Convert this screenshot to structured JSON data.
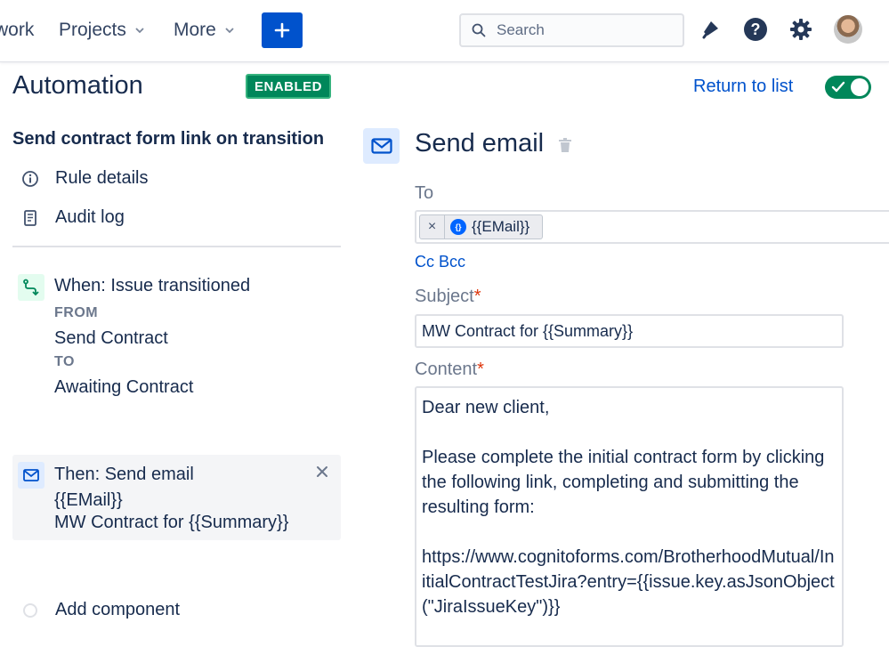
{
  "nav": {
    "work_label": "work",
    "projects_label": "Projects",
    "more_label": "More",
    "create_icon": "plus-icon",
    "search_placeholder": "Search",
    "icons": [
      "notification-icon",
      "help-icon",
      "settings-icon",
      "avatar"
    ]
  },
  "header": {
    "title": "Automation",
    "status_badge": "ENABLED",
    "return_link": "Return to list",
    "rule_enabled": true
  },
  "sidebar": {
    "rule_name": "Send contract form link on transition",
    "links": [
      {
        "label": "Rule details",
        "icon": "info-icon"
      },
      {
        "label": "Audit log",
        "icon": "audit-log-icon"
      }
    ],
    "trigger": {
      "label": "When: Issue transitioned",
      "from_label": "FROM",
      "from_value": "Send Contract",
      "to_label": "TO",
      "to_value": "Awaiting Contract"
    },
    "action": {
      "label": "Then: Send email",
      "line1": "{{EMail}}",
      "line2": "MW Contract for {{Summary}}"
    },
    "add_component": "Add component"
  },
  "editor": {
    "title": "Send email",
    "to_label": "To",
    "to_chip": "{{EMail}}",
    "cc_bcc": "Cc Bcc",
    "subject_label": "Subject",
    "subject_value": "MW Contract for {{Summary}}",
    "content_label": "Content",
    "required_marker": "*",
    "content_lines": {
      "greeting": "Dear new client,",
      "body": "Please complete the initial contract form by clicking the following link, completing and submitting the resulting form:",
      "link": "https://www.cognitoforms.com/BrotherhoodMutual/InitialContractTestJira?entry={{issue.key.asJsonObject(\"JiraIssueKey\")}}"
    }
  },
  "colors": {
    "primary": "#0052cc",
    "enabled_green": "#00875a",
    "text": "#172b4d",
    "muted": "#6b778c"
  }
}
